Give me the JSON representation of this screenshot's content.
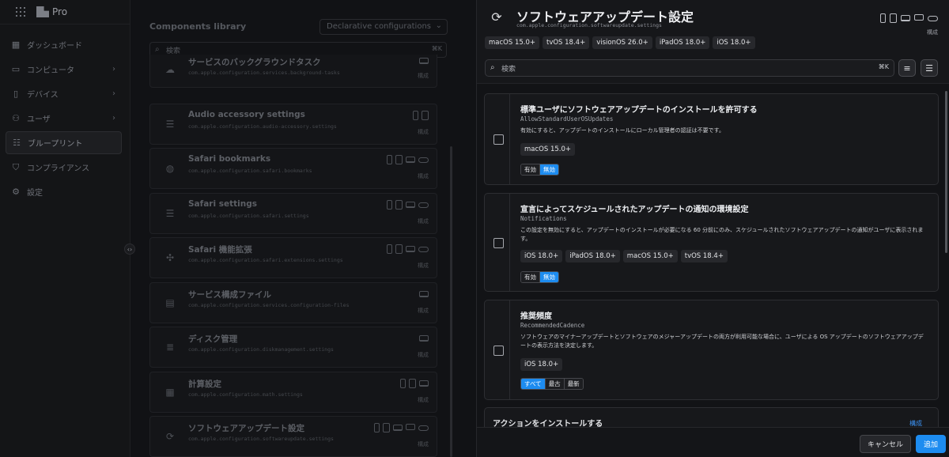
{
  "app": {
    "brand": "Pro"
  },
  "nav": {
    "items": [
      {
        "label": "ダッシュボード",
        "icon": "dashboard-icon",
        "chevron": false,
        "active": false
      },
      {
        "label": "コンピュータ",
        "icon": "computer-icon",
        "chevron": true,
        "active": false
      },
      {
        "label": "デバイス",
        "icon": "devices-icon",
        "chevron": true,
        "active": false
      },
      {
        "label": "ユーザ",
        "icon": "users-icon",
        "chevron": true,
        "active": false
      },
      {
        "label": "ブループリント",
        "icon": "blueprint-icon",
        "chevron": false,
        "active": true
      },
      {
        "label": "コンプライアンス",
        "icon": "shield-icon",
        "chevron": false,
        "active": false
      },
      {
        "label": "設定",
        "icon": "gear-icon",
        "chevron": false,
        "active": false
      }
    ]
  },
  "library": {
    "title": "Components library",
    "dropdown": "Declarative configurations",
    "search_placeholder": "検索",
    "search_shortcut": "⌘K",
    "cards": [
      {
        "name": "サービスのバックグラウンドタスク",
        "id": "com.apple.configuration.services.background-tasks",
        "icon": "cloud-icon",
        "devices": [
          "lp"
        ],
        "label": "構成"
      },
      {
        "name": "Audio accessory settings",
        "id": "com.apple.configuration.audio-accessory.settings",
        "icon": "sliders-icon",
        "devices": [
          "ph",
          "tb"
        ],
        "label": "構成"
      },
      {
        "name": "Safari bookmarks",
        "id": "com.apple.configuration.safari.bookmarks",
        "icon": "globe-icon",
        "devices": [
          "ph",
          "tb",
          "lp",
          "vr"
        ],
        "label": "構成"
      },
      {
        "name": "Safari settings",
        "id": "com.apple.configuration.safari.settings",
        "icon": "sliders-icon",
        "devices": [
          "ph",
          "tb",
          "lp",
          "vr"
        ],
        "label": "構成"
      },
      {
        "name": "Safari 機能拡張",
        "id": "com.apple.configuration.safari.extensions.settings",
        "icon": "puzzle-icon",
        "devices": [
          "ph",
          "tb",
          "lp",
          "vr"
        ],
        "label": "構成"
      },
      {
        "name": "サービス構成ファイル",
        "id": "com.apple.configuration.services.configuration-files",
        "icon": "file-icon",
        "devices": [
          "lp"
        ],
        "label": "構成"
      },
      {
        "name": "ディスク管理",
        "id": "com.apple.configuration.diskmanagement.settings",
        "icon": "disk-icon",
        "devices": [
          "lp"
        ],
        "label": "構成"
      },
      {
        "name": "計算設定",
        "id": "com.apple.configuration.math.settings",
        "icon": "calculator-icon",
        "devices": [
          "ph",
          "tb",
          "lp"
        ],
        "label": "構成"
      },
      {
        "name": "ソフトウェアアップデート設定",
        "id": "com.apple.configuration.softwareupdate.settings",
        "icon": "refresh-icon",
        "devices": [
          "ph",
          "tb",
          "lp",
          "tv",
          "vr"
        ],
        "label": "構成"
      }
    ]
  },
  "panel": {
    "title": "ソフトウェアアップデート設定",
    "id": "com.apple.configuration.softwareupdate.settings",
    "label": "構成",
    "chips": [
      "macOS 15.0+",
      "tvOS 18.4+",
      "visionOS 26.0+",
      "iPadOS 18.0+",
      "iOS 18.0+"
    ],
    "search_placeholder": "検索",
    "search_shortcut": "⌘K",
    "settings": [
      {
        "title": "標準ユーザにソフトウェアアップデートのインストールを許可する",
        "key": "AllowStandardUserOSUpdates",
        "desc": "有効にすると、アップデートのインストールにローカル管理者の認証は不要です。",
        "chips": [
          "macOS 15.0+"
        ],
        "options": [
          "有効",
          "無効"
        ],
        "selected": 1
      },
      {
        "title": "宣言によってスケジュールされたアップデートの通知の環境設定",
        "key": "Notifications",
        "desc": "この設定を無効にすると、アップデートのインストールが必要になる 60 分前にのみ、スケジュールされたソフトウェアアップデートの通知がユーザに表示されます。",
        "chips": [
          "iOS 18.0+",
          "iPadOS 18.0+",
          "macOS 15.0+",
          "tvOS 18.4+"
        ],
        "options": [
          "有効",
          "無効"
        ],
        "selected": 1
      },
      {
        "title": "推奨頻度",
        "key": "RecommendedCadence",
        "desc": "ソフトウェアのマイナーアップデートとソフトウェアのメジャーアップデートの両方が利用可能な場合に、ユーザによる OS アップデートのソフトウェアアップデートの表示方法を決定します。",
        "chips": [
          "iOS 18.0+"
        ],
        "options": [
          "すべて",
          "最古",
          "最新"
        ],
        "selected": 0
      }
    ],
    "action_title": "アクションをインストールする",
    "action_link": "構成",
    "cancel": "キャンセル",
    "add": "追加"
  },
  "colors": {
    "accent": "#1d8cf0",
    "bg": "#111215",
    "panel": "#16171a"
  }
}
